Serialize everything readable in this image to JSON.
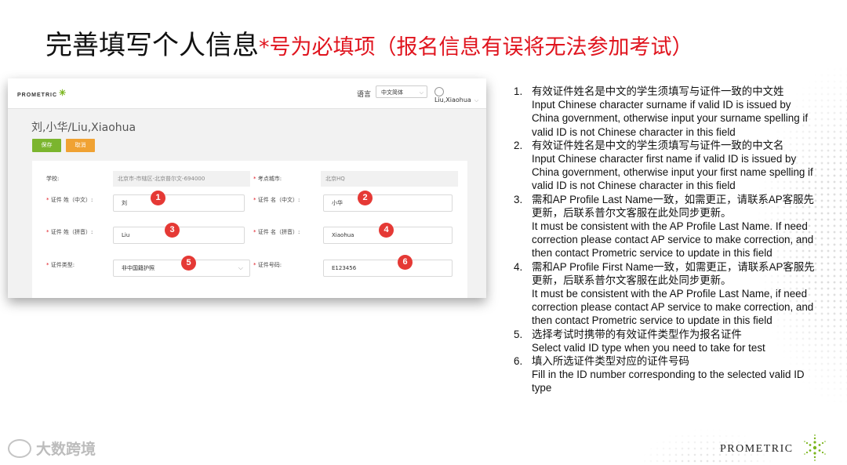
{
  "slide": {
    "title_main": "完善填写个人信息",
    "title_note": "*号为必填项（报名信息有误将无法参加考试）"
  },
  "app": {
    "logo": "PROMETRIC",
    "language_label": "语言",
    "language_value": "中文简体",
    "user_name": "Liu,Xiaohua",
    "profile_name": "刘,小华/Liu,Xiaohua",
    "save_label": "保存",
    "cancel_label": "取消"
  },
  "form": {
    "school_label": "学校:",
    "school_value": "北京市-市辖区-北京普尔文-694000",
    "center_label": "考点城市:",
    "center_value": "北京HQ",
    "surname_cn_label": "证件 姓（中文）:",
    "surname_cn_value": "刘",
    "given_cn_label": "证件 名（中文）:",
    "given_cn_value": "小华",
    "surname_py_label": "证件 姓（拼音）:",
    "surname_py_value": "Liu",
    "given_py_label": "证件 名（拼音）:",
    "given_py_value": "Xiaohua",
    "id_type_label": "证件类型:",
    "id_type_value": "非中国籍护照",
    "id_number_label": "证件号码:",
    "id_number_value": "E123456",
    "badges": [
      "1",
      "2",
      "3",
      "4",
      "5",
      "6"
    ]
  },
  "instructions": [
    {
      "num": "1.",
      "lines": [
        "有效证件姓名是中文的学生须填写与证件一致的中文姓",
        "Input Chinese character surname if valid ID is issued by",
        "China government, otherwise input your surname spelling if",
        "valid ID is not Chinese character in this field"
      ]
    },
    {
      "num": "2.",
      "lines": [
        "有效证件姓名是中文的学生须填写与证件一致的中文名",
        "Input Chinese character first name if valid ID is issued by",
        "China government, otherwise input your first name spelling if",
        "valid ID is not Chinese character in this field"
      ]
    },
    {
      "num": "3.",
      "lines": [
        "需和AP Profile Last Name一致，如需更正，请联系AP客服先",
        "更新，后联系普尔文客服在此处同步更新。",
        "It must be consistent with the AP Profile Last Name. If need",
        "correction please contact AP service to make correction, and",
        "then contact Prometric service to update in this field"
      ]
    },
    {
      "num": "4.",
      "lines": [
        "需和AP Profile First Name一致，如需更正，请联系AP客服先",
        "更新，后联系普尔文客服在此处同步更新。",
        "It must be consistent with the AP Profile Last Name, if need",
        "correction please contact AP service to make correction, and",
        "then contact Prometric service to update in this field"
      ]
    },
    {
      "num": "5.",
      "lines": [
        "选择考试时携带的有效证件类型作为报名证件",
        "Select valid ID type when you need to take for test"
      ]
    },
    {
      "num": "6.",
      "lines": [
        "填入所选证件类型对应的证件号码",
        "Fill in the ID number corresponding to the selected valid ID",
        "type"
      ]
    }
  ],
  "footer": {
    "watermark": "大数跨境",
    "brand": "PROMETRIC"
  },
  "colors": {
    "required_red": "#e0141e",
    "badge_red": "#e53935",
    "save_green": "#7bb52e",
    "cancel_orange": "#f0a233",
    "brand_green": "#7ab51d"
  }
}
